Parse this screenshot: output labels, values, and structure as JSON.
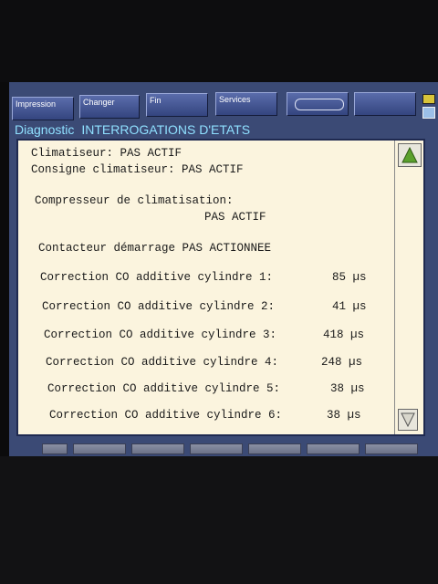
{
  "toolbar": {
    "impression": "Impression",
    "changer": "Changer",
    "fin": "Fin",
    "services": "Services"
  },
  "title": {
    "section": "Diagnostic",
    "page": "INTERROGATIONS D'ETATS"
  },
  "status": {
    "climatiseur": "Climatiseur: PAS ACTIF",
    "consigne": "Consigne climatiseur: PAS ACTIF",
    "compresseur_label": "Compresseur de climatisation:",
    "compresseur_value": "PAS ACTIF",
    "contacteur": "Contacteur démarrage PAS ACTIONNEE"
  },
  "corrections": [
    {
      "label": "Correction CO additive cylindre 1:",
      "value": "85 µs"
    },
    {
      "label": "Correction CO additive cylindre 2:",
      "value": "41 µs"
    },
    {
      "label": "Correction CO additive cylindre 3:",
      "value": "418 µs"
    },
    {
      "label": "Correction CO additive cylindre 4:",
      "value": "248 µs"
    },
    {
      "label": "Correction CO additive cylindre 5:",
      "value": "38 µs"
    },
    {
      "label": "Correction CO additive cylindre 6:",
      "value": "38 µs"
    }
  ],
  "icons": {
    "scroll_up": "triangle-up-icon",
    "scroll_down": "triangle-down-icon",
    "printer": "printer-icon"
  },
  "colors": {
    "screen_bg": "#3b4a75",
    "title_text": "#8fe0ff",
    "panel_bg": "#fbf4de",
    "scroll_up_arrow": "#5aa02c"
  }
}
